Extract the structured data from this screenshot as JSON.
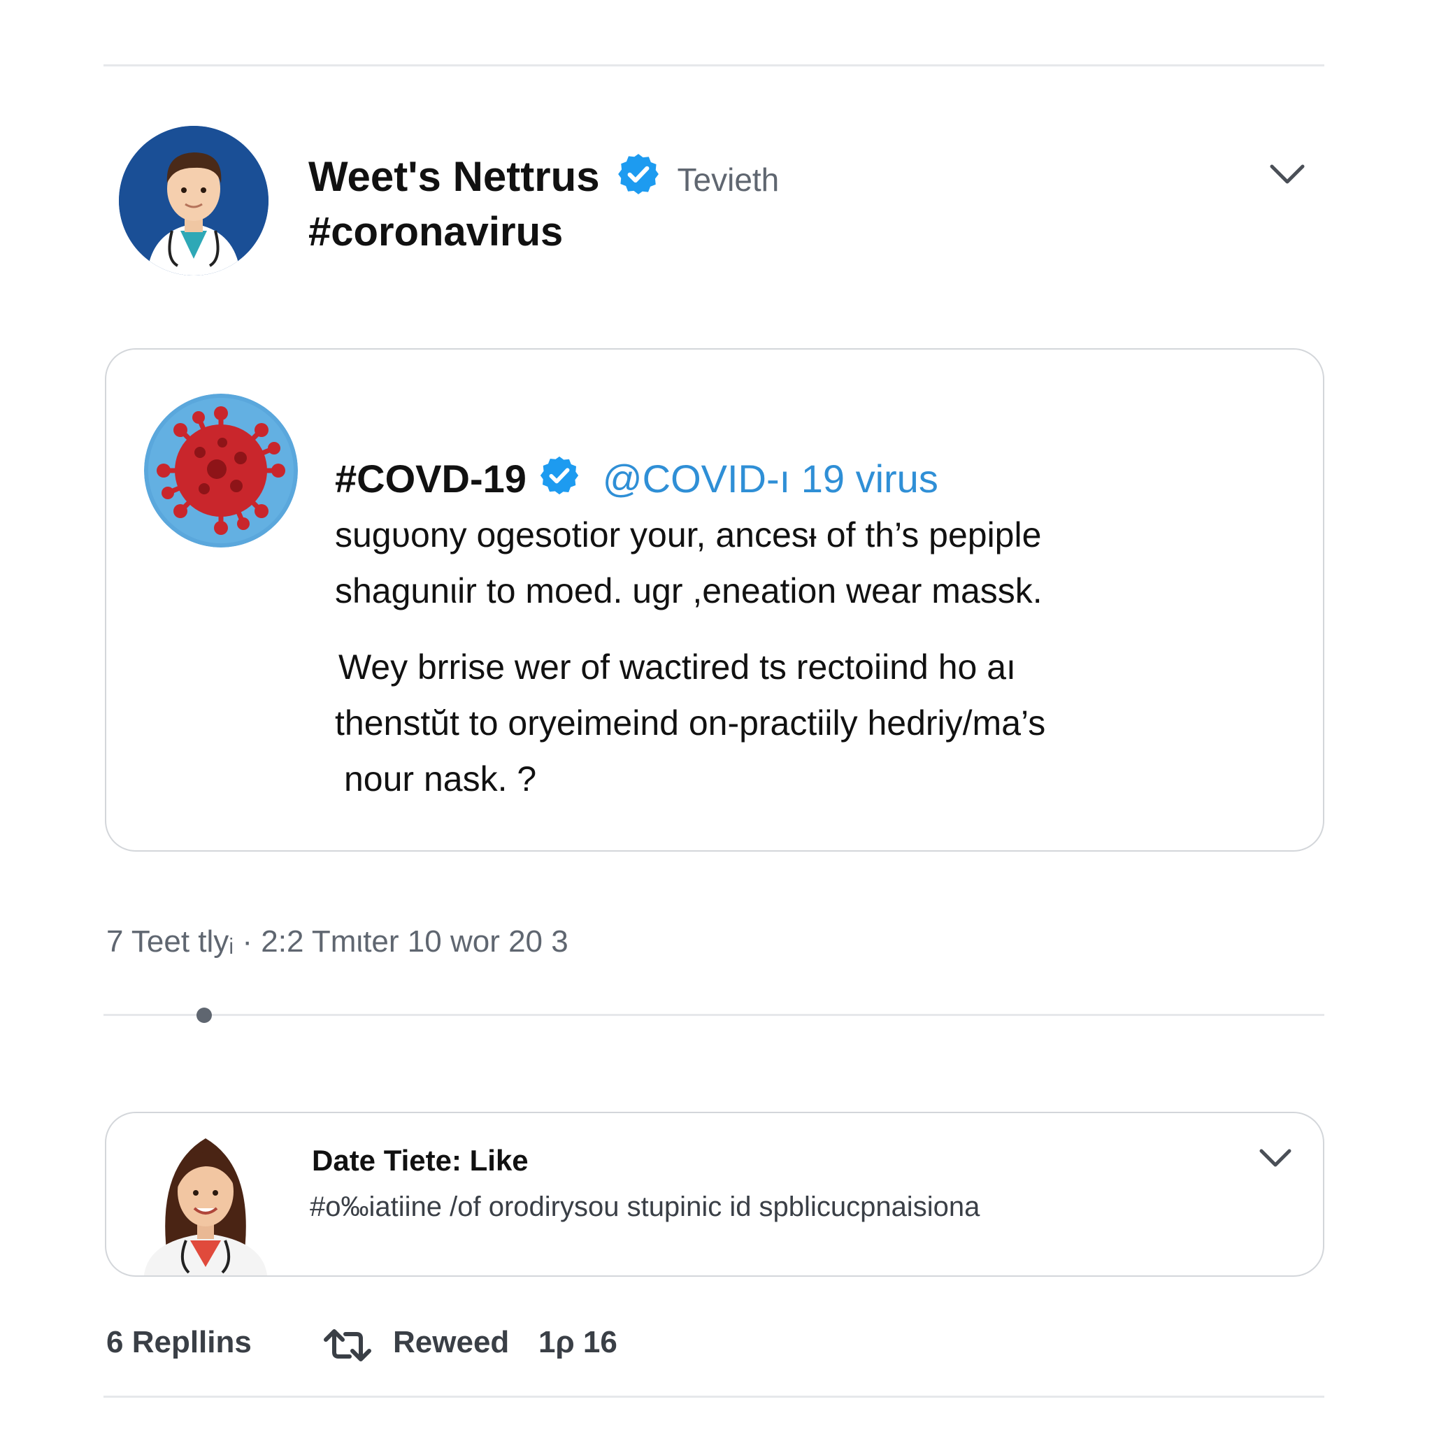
{
  "colors": {
    "accent": "#1d9bf0",
    "handle": "#2f8fd6",
    "text": "#111111",
    "muted": "#5f6670",
    "rule": "#e6e8eb",
    "border": "#d3d6da"
  },
  "icons": {
    "verified": "verified-badge-icon",
    "chevron": "chevron-down-icon",
    "retweet": "retweet-icon",
    "virus": "virus-icon"
  },
  "header_tweet": {
    "author_name": "Weet's Nettrus",
    "author_handle": "Tevieth",
    "hashtag": "#coronavirus"
  },
  "quoted_tweet": {
    "name": "#COVD-19",
    "handle": "@COVID-ı 19 virus",
    "lines": [
      "sugυony ogesotior your, ancesᵼ of th’s pepiple",
      "shagunιir to moed. ugr ,eneation  wear  maѕsk.",
      "Wey brrise wer of wactired ts rectoiind ho aı",
      "thenstŭt to oryeimeind on-practiily hedriy/ma’s",
      "nour nask. ?"
    ]
  },
  "meta": {
    "text": "7 Teet tlyᵢ · 2:2 Tmιter 10 wor 20 3"
  },
  "reply_card": {
    "title": "Date Tiete: Like",
    "body": "#o‰iatiine /of orodirysou stupinic id spblicucpnaisiona"
  },
  "actions": {
    "replies": "6 Repllins",
    "retweet": "Reweed",
    "likes": "1ρ 16"
  }
}
